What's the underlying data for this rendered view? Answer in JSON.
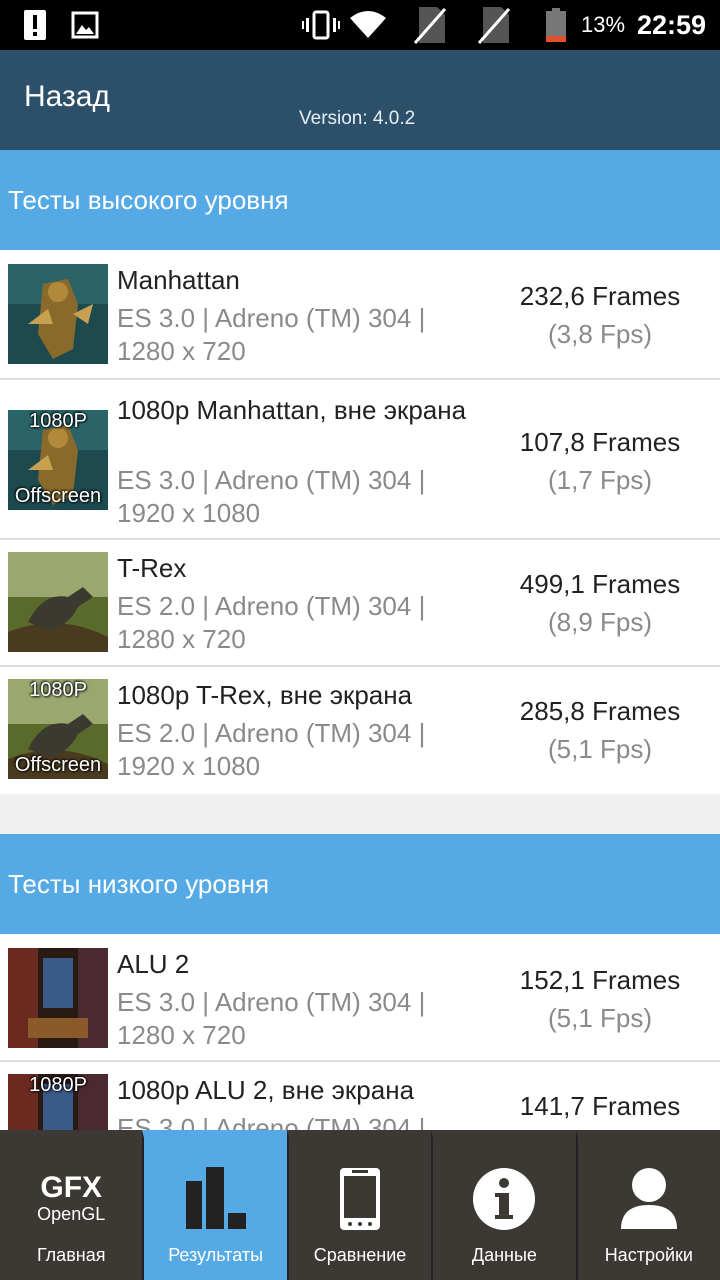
{
  "status_bar": {
    "battery_percent": "13%",
    "time": "22:59"
  },
  "app_bar": {
    "back_label": "Назад",
    "version": "Version: 4.0.2"
  },
  "sections": [
    {
      "title": "Тесты высокого уровня",
      "items": [
        {
          "title": "Manhattan",
          "subtitle": "ES 3.0 | Adreno (TM) 304 | 1280 x 720",
          "score": "232,6 Frames",
          "fps": "(3,8 Fps)",
          "badge_top": "",
          "badge_bottom": ""
        },
        {
          "title": "1080p Manhattan, вне экрана",
          "subtitle": "ES 3.0 | Adreno (TM) 304 | 1920 x 1080",
          "score": "107,8 Frames",
          "fps": "(1,7 Fps)",
          "badge_top": "1080P",
          "badge_bottom": "Offscreen"
        },
        {
          "title": "T-Rex",
          "subtitle": "ES 2.0 | Adreno (TM) 304 | 1280 x 720",
          "score": "499,1 Frames",
          "fps": "(8,9 Fps)",
          "badge_top": "",
          "badge_bottom": ""
        },
        {
          "title": "1080p T-Rex, вне экрана",
          "subtitle": "ES 2.0 | Adreno (TM) 304 | 1920 x 1080",
          "score": "285,8 Frames",
          "fps": "(5,1 Fps)",
          "badge_top": "1080P",
          "badge_bottom": "Offscreen"
        }
      ]
    },
    {
      "title": "Тесты низкого уровня",
      "items": [
        {
          "title": "ALU 2",
          "subtitle": "ES 3.0 | Adreno (TM) 304 | 1280 x 720",
          "score": "152,1 Frames",
          "fps": "(5,1 Fps)",
          "badge_top": "",
          "badge_bottom": ""
        },
        {
          "title": "1080p ALU 2, вне экрана",
          "subtitle": "ES 3.0 | Adreno (TM) 304 |",
          "score": "141,7 Frames",
          "fps": "",
          "badge_top": "1080P",
          "badge_bottom": ""
        }
      ]
    }
  ],
  "bottom_nav": [
    {
      "label": "Главная",
      "logo_line1": "GFX",
      "logo_line2": "OpenGL"
    },
    {
      "label": "Результаты"
    },
    {
      "label": "Сравнение"
    },
    {
      "label": "Данные"
    },
    {
      "label": "Настройки"
    }
  ],
  "icons": {
    "status_left": [
      "alert-icon",
      "image-icon"
    ],
    "status_right": [
      "vibrate-icon",
      "wifi-icon",
      "no-sim-icon",
      "no-sim-icon",
      "battery-icon"
    ],
    "thumbnails": [
      "manhattan-thumbnail",
      "manhattan-thumbnail",
      "trex-thumbnail",
      "trex-thumbnail",
      "alu-thumbnail",
      "alu-thumbnail"
    ],
    "nav": [
      "gfx-logo",
      "bar-chart-icon",
      "phone-icon",
      "info-icon",
      "user-icon"
    ]
  },
  "colors": {
    "app_bar": "#2c5069",
    "section_header": "#55aae6",
    "nav_bg": "#3c3833",
    "nav_active": "#55aae6",
    "battery_low": "#e0502a"
  }
}
